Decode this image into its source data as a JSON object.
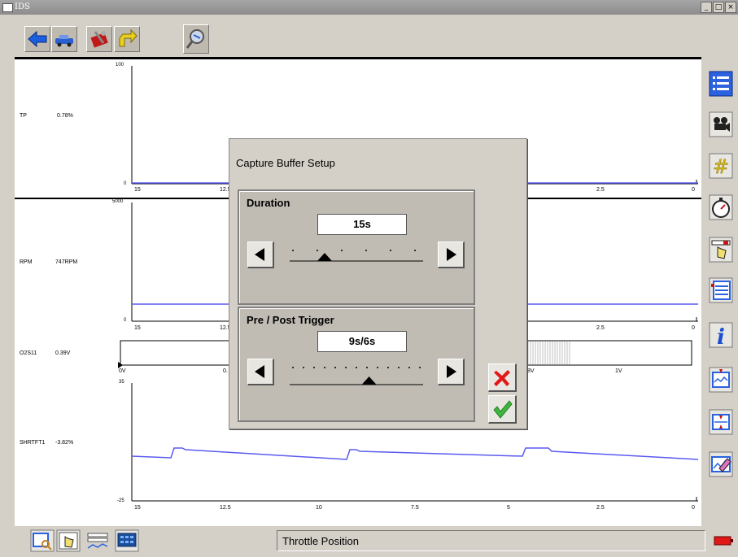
{
  "window": {
    "title": "IDS",
    "controls": [
      "_",
      "□",
      "×"
    ]
  },
  "toolbar": {
    "icons": [
      "back-arrow-icon",
      "vehicle-icon",
      "toolbox-icon",
      "forward-arrow-icon",
      "datalogger-icon"
    ]
  },
  "channels": [
    {
      "name": "TP",
      "value": "0.78%",
      "ymax": "100",
      "ymin": "0"
    },
    {
      "name": "RPM",
      "value": "747RPM",
      "ymax": "5000",
      "ymin": "0"
    },
    {
      "name": "O2S11",
      "value": "0.39V"
    },
    {
      "name": "SHRTFT1",
      "value": "-3.82%",
      "ymax": "35",
      "ymin": "-25"
    }
  ],
  "time_ticks": [
    "15",
    "12.5",
    "10",
    "7.5",
    "5",
    "2.5",
    "0"
  ],
  "o2_ticks": [
    "0V",
    "0.",
    ".8V",
    "1V"
  ],
  "dialog": {
    "title": "Capture Buffer Setup",
    "duration": {
      "label": "Duration",
      "value": "15s",
      "position": 0.25
    },
    "trigger": {
      "label": "Pre / Post Trigger",
      "value": "9s/6s",
      "position": 0.6
    }
  },
  "status": {
    "text": "Throttle Position"
  },
  "colors": {
    "trace": "#5a5af0",
    "accent": "#0033cc"
  }
}
